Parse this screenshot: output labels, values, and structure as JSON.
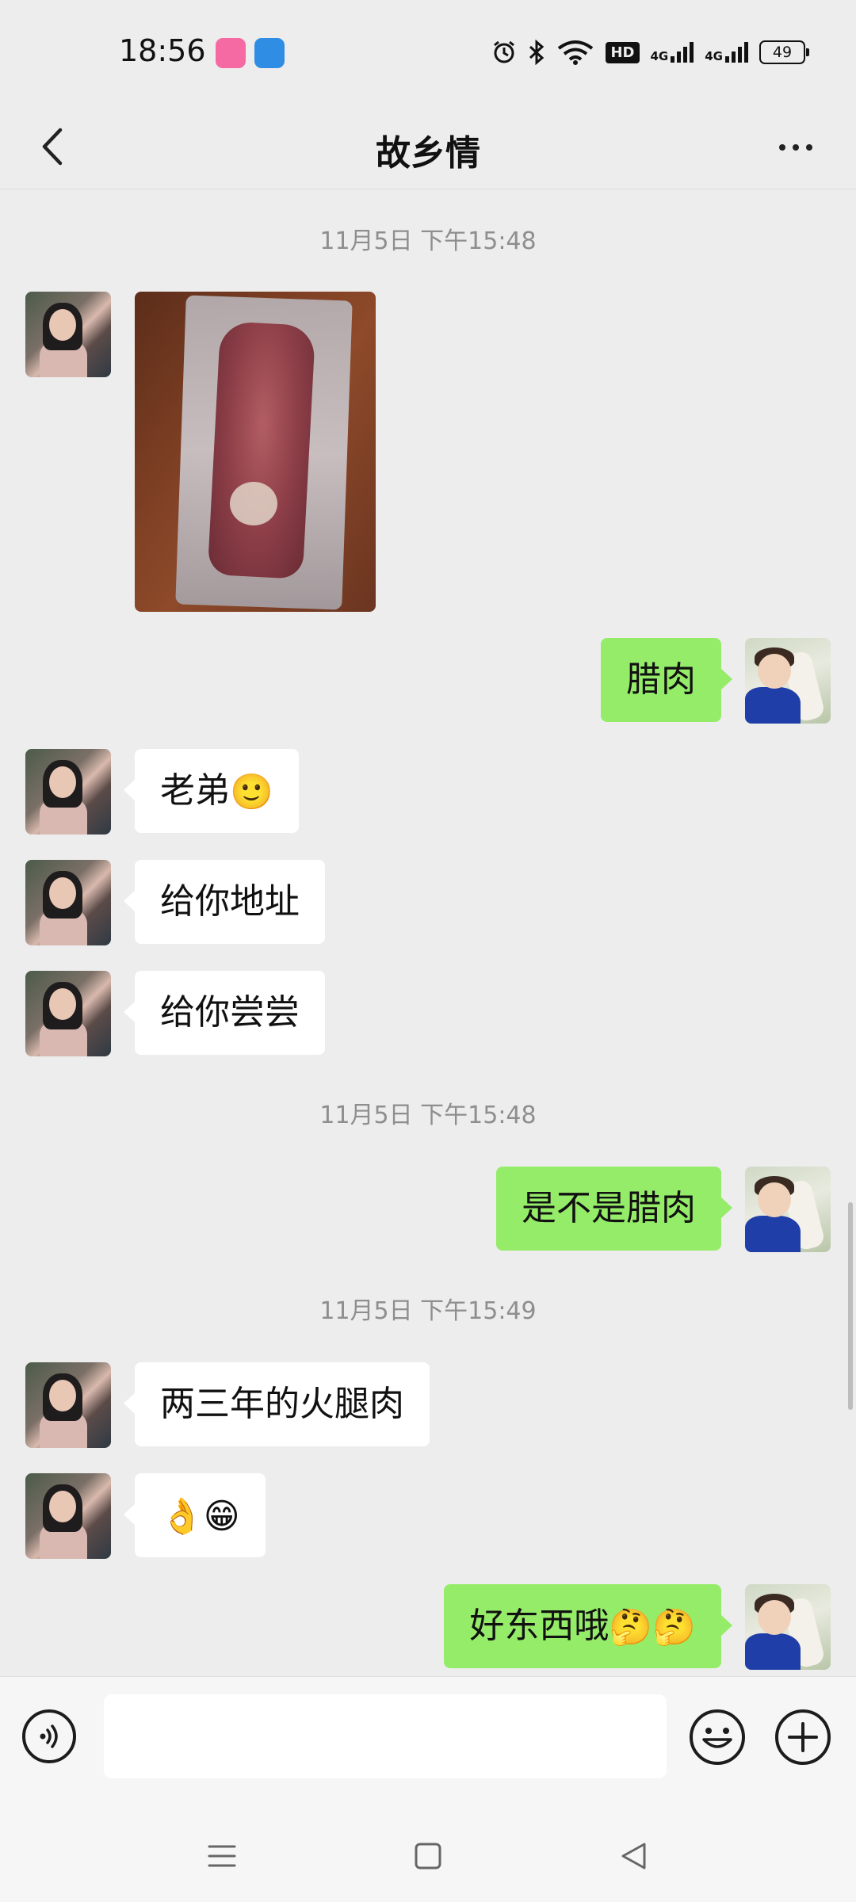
{
  "status_bar": {
    "time": "18:56",
    "app_icons": [
      "bilibili-icon",
      "browser-icon"
    ],
    "hd_label": "HD",
    "network_labels": [
      "4G",
      "4G"
    ],
    "battery": "49"
  },
  "header": {
    "title": "故乡情",
    "back_icon": "chevron-left-icon",
    "more_icon": "more-dots-icon"
  },
  "messages": {
    "ts1": "11月5日 下午15:48",
    "m2": "腊肉",
    "m3_text": "老弟",
    "m3_emoji": "🙂",
    "m4": "给你地址",
    "m5": "给你尝尝",
    "ts2": "11月5日 下午15:48",
    "m6": "是不是腊肉",
    "ts3": "11月5日 下午15:49",
    "m7": "两三年的火腿肉",
    "m8_emoji": "👌😁",
    "m9_text": "好东西哦",
    "m9_emoji": "🤔🤔"
  },
  "input_bar": {
    "value": "",
    "voice_icon": "voice-icon",
    "emoji_icon": "smile-icon",
    "plus_icon": "plus-icon"
  },
  "nav_bar": {
    "icons": [
      "menu-icon",
      "home-square-icon",
      "back-triangle-icon"
    ]
  },
  "colors": {
    "background": "#ededed",
    "outgoing_bubble": "#95ec69",
    "incoming_bubble": "#ffffff",
    "timestamp": "#8e8e8e"
  }
}
